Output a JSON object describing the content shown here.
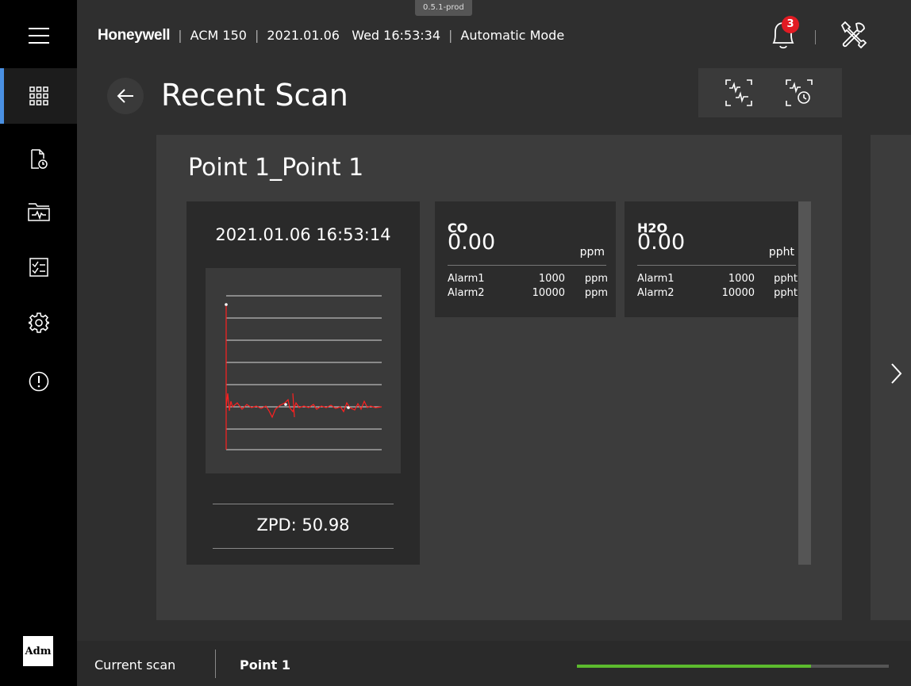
{
  "header": {
    "version": "0.5.1-prod",
    "brand": "Honeywell",
    "device": "ACM 150",
    "date": "2021.01.06",
    "day_time": "Wed 16:53:34",
    "mode": "Automatic Mode",
    "alert_count": "3"
  },
  "page": {
    "title": "Recent Scan"
  },
  "card": {
    "title": "Point 1_Point 1",
    "scan_time": "2021.01.06 16:53:14",
    "zpd": "ZPD: 50.98",
    "gases": [
      {
        "name": "CO",
        "value": "0.00",
        "unit": "ppm",
        "alarms": [
          {
            "label": "Alarm1",
            "value": "1000",
            "unit": "ppm"
          },
          {
            "label": "Alarm2",
            "value": "10000",
            "unit": "ppm"
          }
        ]
      },
      {
        "name": "H2O",
        "value": "0.00",
        "unit": "ppht",
        "alarms": [
          {
            "label": "Alarm1",
            "value": "1000",
            "unit": "ppht"
          },
          {
            "label": "Alarm2",
            "value": "10000",
            "unit": "ppht"
          }
        ]
      }
    ]
  },
  "bottom": {
    "label": "Current scan",
    "point": "Point 1",
    "progress_fraction": 0.75
  },
  "user": {
    "initials": "Adm"
  },
  "colors": {
    "accent": "#4a90e2",
    "alert": "#e21b23",
    "progress": "#5cbb2e",
    "signal": "#ff2020"
  },
  "icons": [
    "menu-icon",
    "dashboard-icon",
    "report-clock-icon",
    "folder-waveform-icon",
    "checklist-icon",
    "gear-icon",
    "alert-circle-icon",
    "bell-icon",
    "tools-icon",
    "back-arrow-icon",
    "scan-waveform-icon",
    "scan-timer-icon",
    "chevron-right-icon"
  ]
}
